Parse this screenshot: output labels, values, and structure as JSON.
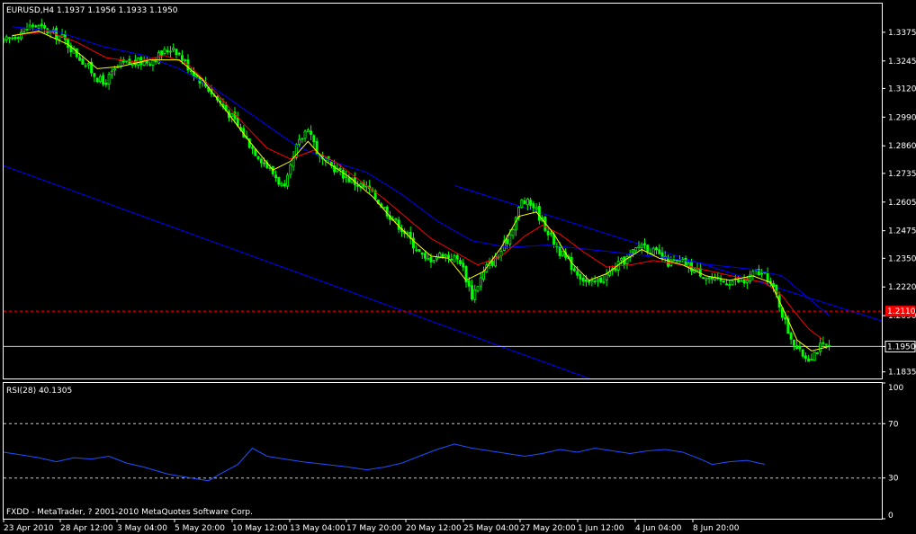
{
  "header": {
    "symbol_line": "EURUSD,H4  1.1937 1.1956 1.1933 1.1950"
  },
  "rsi_panel": {
    "title": "RSI(28) 40.1305",
    "ticks": [
      "100",
      "70",
      "30",
      "0"
    ],
    "copyright": "FXDD - MetaTrader, ? 2001-2010 MetaQuotes Software Corp."
  },
  "colors": {
    "background": "#000000",
    "frame": "#ffffff",
    "bull_candle": "#00ff00",
    "bear_candle": "#00ff00",
    "ma_fast": "#ffff00",
    "ma_mid": "#ff0000",
    "ma_slow": "#0000ff",
    "trendline": "#0000ff",
    "alert_line": "#ff0000",
    "current_price_line": "#ffffff",
    "rsi_line": "#1e50ff",
    "rsi_level": "#ffffff"
  },
  "chart_data": [
    {
      "type": "candlestick",
      "title": "EURUSD,H4  1.1937 1.1956 1.1933 1.1950",
      "y_ticks": [
        "1.3375",
        "1.3245",
        "1.3120",
        "1.2990",
        "1.2860",
        "1.2735",
        "1.2605",
        "1.2475",
        "1.2350",
        "1.2220",
        "1.2090",
        "1.1950",
        "1.1835"
      ],
      "ylim": [
        1.1805,
        1.3505
      ],
      "x_ticks": [
        "23 Apr 2010",
        "28 Apr 12:00",
        "3 May 04:00",
        "5 May 20:00",
        "10 May 12:00",
        "13 May 04:00",
        "17 May 20:00",
        "20 May 12:00",
        "25 May 04:00",
        "27 May 20:00",
        "1 Jun 12:00",
        "4 Jun 04:00",
        "8 Jun 20:00"
      ],
      "alert_level": {
        "value": 1.211,
        "label": "1.2110"
      },
      "current_price": {
        "value": 1.195,
        "label": "1.1950"
      },
      "close_path": [
        [
          0,
          1.333
        ],
        [
          10,
          1.341
        ],
        [
          20,
          1.335
        ],
        [
          28,
          1.323
        ],
        [
          34,
          1.314
        ],
        [
          40,
          1.323
        ],
        [
          50,
          1.3245
        ],
        [
          58,
          1.331
        ],
        [
          63,
          1.322
        ],
        [
          70,
          1.312
        ],
        [
          78,
          1.299
        ],
        [
          85,
          1.285
        ],
        [
          93,
          1.272
        ],
        [
          96,
          1.266
        ],
        [
          100,
          1.285
        ],
        [
          104,
          1.295
        ],
        [
          108,
          1.28
        ],
        [
          113,
          1.276
        ],
        [
          119,
          1.27
        ],
        [
          125,
          1.266
        ],
        [
          131,
          1.256
        ],
        [
          137,
          1.247
        ],
        [
          144,
          1.234
        ],
        [
          150,
          1.237
        ],
        [
          156,
          1.234
        ],
        [
          160,
          1.218
        ],
        [
          165,
          1.231
        ],
        [
          169,
          1.236
        ],
        [
          173,
          1.246
        ],
        [
          177,
          1.261
        ],
        [
          181,
          1.259
        ],
        [
          186,
          1.247
        ],
        [
          190,
          1.238
        ],
        [
          195,
          1.23
        ],
        [
          200,
          1.223
        ],
        [
          205,
          1.226
        ],
        [
          210,
          1.232
        ],
        [
          214,
          1.236
        ],
        [
          218,
          1.242
        ],
        [
          222,
          1.238
        ],
        [
          227,
          1.233
        ],
        [
          232,
          1.233
        ],
        [
          236,
          1.23
        ],
        [
          240,
          1.227
        ],
        [
          244,
          1.224
        ],
        [
          249,
          1.225
        ],
        [
          253,
          1.224
        ],
        [
          257,
          1.229
        ],
        [
          261,
          1.226
        ],
        [
          264,
          1.218
        ],
        [
          268,
          1.202
        ],
        [
          272,
          1.192
        ],
        [
          275,
          1.19
        ],
        [
          279,
          1.195
        ],
        [
          282,
          1.195
        ]
      ],
      "ma_fast": [
        [
          3,
          1.336
        ],
        [
          12,
          1.338
        ],
        [
          22,
          1.332
        ],
        [
          32,
          1.321
        ],
        [
          40,
          1.322
        ],
        [
          50,
          1.325
        ],
        [
          60,
          1.325
        ],
        [
          68,
          1.316
        ],
        [
          76,
          1.302
        ],
        [
          84,
          1.288
        ],
        [
          92,
          1.275
        ],
        [
          98,
          1.279
        ],
        [
          104,
          1.288
        ],
        [
          110,
          1.279
        ],
        [
          118,
          1.272
        ],
        [
          126,
          1.263
        ],
        [
          134,
          1.251
        ],
        [
          140,
          1.243
        ],
        [
          146,
          1.236
        ],
        [
          152,
          1.235
        ],
        [
          158,
          1.225
        ],
        [
          164,
          1.229
        ],
        [
          170,
          1.24
        ],
        [
          176,
          1.254
        ],
        [
          182,
          1.256
        ],
        [
          188,
          1.246
        ],
        [
          194,
          1.233
        ],
        [
          200,
          1.225
        ],
        [
          206,
          1.228
        ],
        [
          212,
          1.234
        ],
        [
          218,
          1.239
        ],
        [
          224,
          1.235
        ],
        [
          232,
          1.232
        ],
        [
          240,
          1.227
        ],
        [
          248,
          1.225
        ],
        [
          256,
          1.227
        ],
        [
          262,
          1.224
        ],
        [
          267,
          1.21
        ],
        [
          271,
          1.198
        ],
        [
          276,
          1.193
        ],
        [
          282,
          1.195
        ]
      ],
      "ma_mid": [
        [
          3,
          1.336
        ],
        [
          15,
          1.338
        ],
        [
          25,
          1.333
        ],
        [
          35,
          1.326
        ],
        [
          45,
          1.324
        ],
        [
          55,
          1.327
        ],
        [
          63,
          1.323
        ],
        [
          72,
          1.311
        ],
        [
          82,
          1.296
        ],
        [
          90,
          1.285
        ],
        [
          98,
          1.28
        ],
        [
          106,
          1.284
        ],
        [
          114,
          1.278
        ],
        [
          122,
          1.27
        ],
        [
          130,
          1.262
        ],
        [
          138,
          1.253
        ],
        [
          146,
          1.244
        ],
        [
          154,
          1.238
        ],
        [
          162,
          1.232
        ],
        [
          170,
          1.236
        ],
        [
          178,
          1.245
        ],
        [
          184,
          1.25
        ],
        [
          190,
          1.246
        ],
        [
          198,
          1.238
        ],
        [
          206,
          1.231
        ],
        [
          214,
          1.232
        ],
        [
          222,
          1.234
        ],
        [
          232,
          1.232
        ],
        [
          242,
          1.229
        ],
        [
          252,
          1.226
        ],
        [
          260,
          1.224
        ],
        [
          266,
          1.218
        ],
        [
          270,
          1.211
        ],
        [
          275,
          1.203
        ],
        [
          280,
          1.198
        ]
      ],
      "ma_slow": [
        [
          3,
          1.34
        ],
        [
          18,
          1.338
        ],
        [
          34,
          1.331
        ],
        [
          48,
          1.327
        ],
        [
          60,
          1.321
        ],
        [
          72,
          1.312
        ],
        [
          86,
          1.299
        ],
        [
          100,
          1.286
        ],
        [
          112,
          1.279
        ],
        [
          124,
          1.274
        ],
        [
          136,
          1.264
        ],
        [
          148,
          1.252
        ],
        [
          160,
          1.243
        ],
        [
          172,
          1.24
        ],
        [
          186,
          1.241
        ],
        [
          200,
          1.239
        ],
        [
          214,
          1.237
        ],
        [
          228,
          1.235
        ],
        [
          242,
          1.232
        ],
        [
          256,
          1.23
        ],
        [
          266,
          1.227
        ],
        [
          274,
          1.218
        ],
        [
          282,
          1.209
        ]
      ],
      "upper_channel": [
        [
          154,
          1.268
        ],
        [
          330,
          1.194
        ]
      ],
      "lower_channel": [
        [
          0,
          1.277
        ],
        [
          200,
          1.1805
        ]
      ]
    },
    {
      "type": "line",
      "title": "RSI(28) 40.1305",
      "ylim": [
        0,
        100
      ],
      "levels": [
        70,
        30
      ],
      "y_ticks": [
        "100",
        "70",
        "30",
        "0"
      ],
      "series": [
        {
          "values": [
            [
              0,
              49
            ],
            [
              6,
              47
            ],
            [
              12,
              45
            ],
            [
              18,
              42
            ],
            [
              24,
              45
            ],
            [
              30,
              44
            ],
            [
              36,
              46
            ],
            [
              42,
              41
            ],
            [
              48,
              38
            ],
            [
              56,
              33
            ],
            [
              64,
              30
            ],
            [
              70,
              28
            ],
            [
              74,
              33
            ],
            [
              80,
              40
            ],
            [
              85,
              52
            ],
            [
              90,
              46
            ],
            [
              96,
              44
            ],
            [
              102,
              42
            ],
            [
              110,
              40
            ],
            [
              118,
              38
            ],
            [
              124,
              36
            ],
            [
              130,
              38
            ],
            [
              136,
              41
            ],
            [
              142,
              46
            ],
            [
              148,
              51
            ],
            [
              154,
              55
            ],
            [
              160,
              52
            ],
            [
              166,
              50
            ],
            [
              172,
              48
            ],
            [
              178,
              46
            ],
            [
              184,
              48
            ],
            [
              190,
              51
            ],
            [
              196,
              49
            ],
            [
              202,
              52
            ],
            [
              208,
              50
            ],
            [
              214,
              48
            ],
            [
              220,
              50
            ],
            [
              226,
              51
            ],
            [
              232,
              49
            ],
            [
              238,
              44
            ],
            [
              242,
              40
            ],
            [
              248,
              42
            ],
            [
              254,
              43
            ],
            [
              258,
              41
            ],
            [
              260,
              40.1
            ]
          ]
        }
      ]
    }
  ]
}
